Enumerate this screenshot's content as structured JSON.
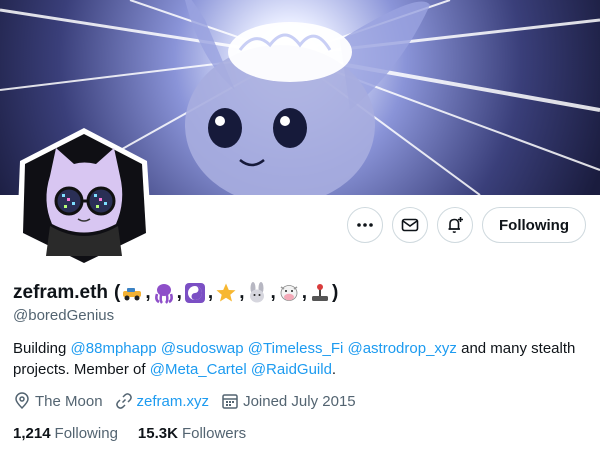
{
  "profile": {
    "display_name": "zefram.eth",
    "handle": "@boredGenius",
    "bio": {
      "prefix": "Building ",
      "mentions_1": [
        "@88mphapp",
        "@sudoswap",
        "@Timeless_Fi",
        "@astrodrop_xyz"
      ],
      "middle": " and many stealth projects. Member of ",
      "mentions_2": [
        "@Meta_Cartel",
        "@RaidGuild"
      ],
      "suffix": "."
    },
    "location": "The Moon",
    "website": "zefram.xyz",
    "joined": "Joined July 2015",
    "following_count": "1,214",
    "following_label": "Following",
    "followers_count": "15.3K",
    "followers_label": "Followers"
  },
  "name_emojis": [
    "race-car-emoji",
    "octopus-emoji",
    "yin-yang-emoji",
    "star-emoji",
    "rabbit-emoji",
    "cow-emoji",
    "joystick-emoji"
  ],
  "actions": {
    "follow_label": "Following"
  },
  "colors": {
    "link": "#1d9bf0",
    "secondary_text": "#536471",
    "border": "#cfd9de",
    "banner_bg": "#1b1f4a"
  }
}
